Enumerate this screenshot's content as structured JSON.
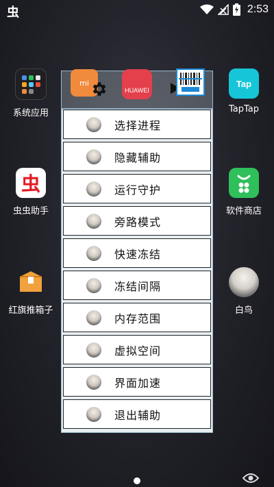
{
  "status_bar": {
    "app_logo": "虫",
    "time": "2:53"
  },
  "desktop": {
    "apps": [
      {
        "label": "系统应用"
      },
      {
        "label": "TapTap",
        "icon_text": "Tap"
      },
      {
        "label": "虫虫助手",
        "icon_text": "虫"
      },
      {
        "label": "软件商店"
      },
      {
        "label": "红旗推箱子"
      },
      {
        "label": "白鸟"
      }
    ],
    "strip_icons": [
      {
        "icon_text": "mi"
      },
      {
        "icon_text": "HUAWEI"
      }
    ]
  },
  "menu": {
    "items": [
      {
        "label": "选择进程"
      },
      {
        "label": "隐藏辅助"
      },
      {
        "label": "运行守护"
      },
      {
        "label": "旁路模式"
      },
      {
        "label": "快速冻结"
      },
      {
        "label": "冻结间隔"
      },
      {
        "label": "内存范围"
      },
      {
        "label": "虚拟空间"
      },
      {
        "label": "界面加速"
      },
      {
        "label": "退出辅助"
      }
    ]
  },
  "colors": {
    "menu_bg": "#ffffff",
    "panel_bg": "#e6eef2",
    "accent_orange": "#f08a3c",
    "red": "#e31b23",
    "green": "#2fbf5b",
    "taptap": "#16c6d8"
  }
}
